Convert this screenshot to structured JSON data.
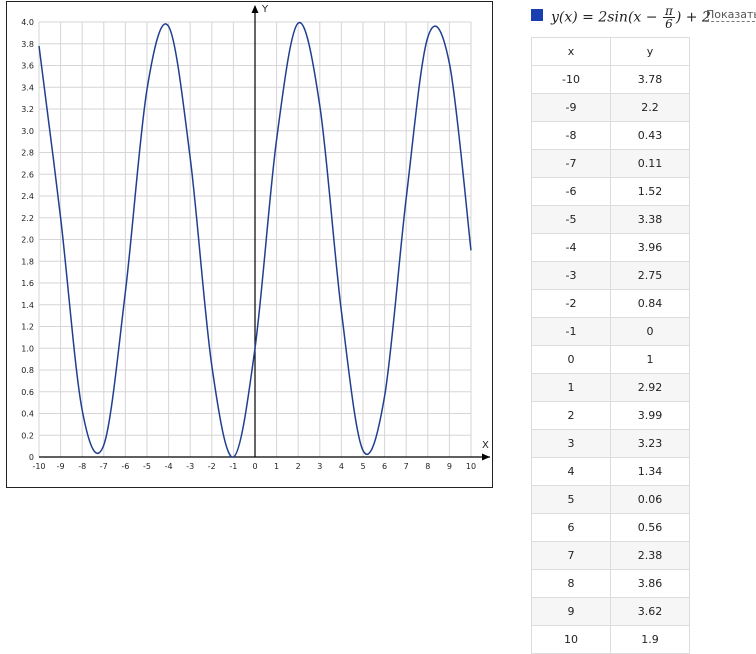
{
  "chart_data": {
    "type": "line",
    "xlabel": "X",
    "ylabel": "Y",
    "xlim": [
      -10,
      10
    ],
    "ylim": [
      0,
      4
    ],
    "x_ticks": [
      -10,
      -9,
      -8,
      -7,
      -6,
      -5,
      -4,
      -3,
      -2,
      -1,
      0,
      1,
      2,
      3,
      4,
      5,
      6,
      7,
      8,
      9,
      10
    ],
    "y_ticks": [
      "0",
      "0.2",
      "0.4",
      "0.6",
      "0.8",
      "1.0",
      "1.2",
      "1.4",
      "1.6",
      "1.8",
      "2.0",
      "2.2",
      "2.4",
      "2.6",
      "2.8",
      "3.0",
      "3.2",
      "3.4",
      "3.6",
      "3.8",
      "4.0"
    ],
    "grid": true,
    "series": [
      {
        "color": "#1f3f8f",
        "x": [
          -10,
          -9,
          -8,
          -7,
          -6,
          -5,
          -4,
          -3,
          -2,
          -1,
          0,
          1,
          2,
          3,
          4,
          5,
          6,
          7,
          8,
          9,
          10
        ],
        "y": [
          3.78,
          2.2,
          0.43,
          0.11,
          1.52,
          3.38,
          3.96,
          2.75,
          0.84,
          0,
          1,
          2.92,
          3.99,
          3.23,
          1.34,
          0.06,
          0.56,
          2.38,
          3.86,
          3.62,
          1.9
        ]
      }
    ]
  },
  "legend": {
    "swatch_color": "#1a3fb0",
    "formula_prefix": "y(x) = 2sin(x − ",
    "formula_pi": "π",
    "formula_den": "6",
    "formula_suffix": ") + 2"
  },
  "show_link": "Показать",
  "table": {
    "headers": [
      "x",
      "y"
    ],
    "rows": [
      [
        "-10",
        "3.78"
      ],
      [
        "-9",
        "2.2"
      ],
      [
        "-8",
        "0.43"
      ],
      [
        "-7",
        "0.11"
      ],
      [
        "-6",
        "1.52"
      ],
      [
        "-5",
        "3.38"
      ],
      [
        "-4",
        "3.96"
      ],
      [
        "-3",
        "2.75"
      ],
      [
        "-2",
        "0.84"
      ],
      [
        "-1",
        "0"
      ],
      [
        "0",
        "1"
      ],
      [
        "1",
        "2.92"
      ],
      [
        "2",
        "3.99"
      ],
      [
        "3",
        "3.23"
      ],
      [
        "4",
        "1.34"
      ],
      [
        "5",
        "0.06"
      ],
      [
        "6",
        "0.56"
      ],
      [
        "7",
        "2.38"
      ],
      [
        "8",
        "3.86"
      ],
      [
        "9",
        "3.62"
      ],
      [
        "10",
        "1.9"
      ]
    ]
  }
}
